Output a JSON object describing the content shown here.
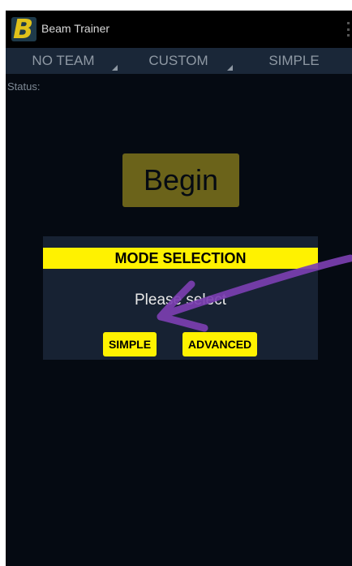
{
  "app": {
    "title": "Beam Trainer",
    "logo_letter": "B"
  },
  "spinners": [
    {
      "label": "NO TEAM"
    },
    {
      "label": "CUSTOM"
    },
    {
      "label": "SIMPLE"
    }
  ],
  "status": {
    "label": "Status:"
  },
  "main": {
    "begin_label": "Begin"
  },
  "dialog": {
    "title": "MODE SELECTION",
    "message": "Please select",
    "simple_label": "SIMPLE",
    "advanced_label": "ADVANCED"
  },
  "colors": {
    "background": "#050a12",
    "accent_yellow": "#fff200",
    "begin_button": "#6b631a",
    "annotation_arrow": "#7b3fb0"
  },
  "icons": {
    "overflow": "overflow-menu-icon",
    "spinner_indicator": "dropdown-triangle-icon",
    "annotation": "hand-drawn-arrow-icon"
  }
}
